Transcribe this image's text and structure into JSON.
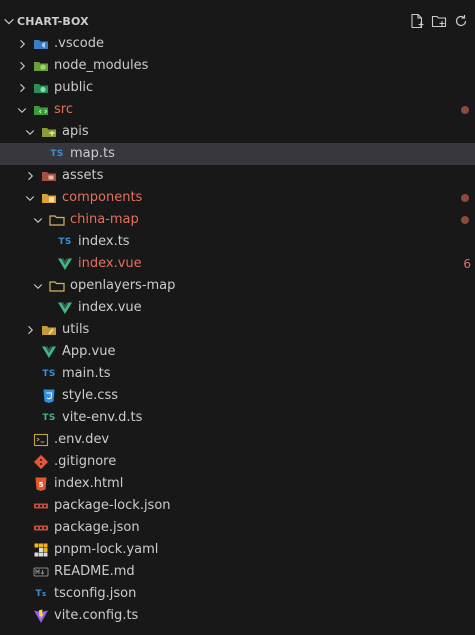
{
  "explorer": {
    "title": "CHART-BOX",
    "actions": [
      "new-file-icon",
      "new-folder-icon",
      "refresh-icon"
    ]
  },
  "tree": [
    {
      "label": ".vscode",
      "kind": "folder",
      "icon": "vscode-folder-icon",
      "depth": 0,
      "expanded": false
    },
    {
      "label": "node_modules",
      "kind": "folder",
      "icon": "node-folder-icon",
      "depth": 0,
      "expanded": false
    },
    {
      "label": "public",
      "kind": "folder",
      "icon": "public-folder-icon",
      "depth": 0,
      "expanded": false
    },
    {
      "label": "src",
      "kind": "folder",
      "icon": "src-folder-icon",
      "depth": 0,
      "expanded": true,
      "modified": true,
      "dot": true
    },
    {
      "label": "apis",
      "kind": "folder",
      "icon": "api-folder-icon",
      "depth": 1,
      "expanded": true
    },
    {
      "label": "map.ts",
      "kind": "file",
      "icon": "typescript-icon",
      "depth": 2,
      "selected": true
    },
    {
      "label": "assets",
      "kind": "folder",
      "icon": "assets-folder-icon",
      "depth": 1,
      "expanded": false
    },
    {
      "label": "components",
      "kind": "folder",
      "icon": "components-folder-icon",
      "depth": 1,
      "expanded": true,
      "modified": true,
      "dot": true
    },
    {
      "label": "china-map",
      "kind": "folder",
      "icon": "folder-icon",
      "depth": 2,
      "expanded": true,
      "modified": true,
      "dot": true
    },
    {
      "label": "index.ts",
      "kind": "file",
      "icon": "typescript-icon",
      "depth": 3
    },
    {
      "label": "index.vue",
      "kind": "file",
      "icon": "vue-icon",
      "depth": 3,
      "modified": true,
      "count": "6"
    },
    {
      "label": "openlayers-map",
      "kind": "folder",
      "icon": "folder-icon",
      "depth": 2,
      "expanded": true
    },
    {
      "label": "index.vue",
      "kind": "file",
      "icon": "vue-icon",
      "depth": 3
    },
    {
      "label": "utils",
      "kind": "folder",
      "icon": "utils-folder-icon",
      "depth": 1,
      "expanded": false
    },
    {
      "label": "App.vue",
      "kind": "file",
      "icon": "vue-icon",
      "depth": 1
    },
    {
      "label": "main.ts",
      "kind": "file",
      "icon": "typescript-icon",
      "depth": 1
    },
    {
      "label": "style.css",
      "kind": "file",
      "icon": "css-icon",
      "depth": 1
    },
    {
      "label": "vite-env.d.ts",
      "kind": "file",
      "icon": "typescript-def-icon",
      "depth": 1
    },
    {
      "label": ".env.dev",
      "kind": "file",
      "icon": "env-icon",
      "depth": 0
    },
    {
      "label": ".gitignore",
      "kind": "file",
      "icon": "git-icon",
      "depth": 0
    },
    {
      "label": "index.html",
      "kind": "file",
      "icon": "html-icon",
      "depth": 0
    },
    {
      "label": "package-lock.json",
      "kind": "file",
      "icon": "npm-icon",
      "depth": 0
    },
    {
      "label": "package.json",
      "kind": "file",
      "icon": "npm-icon",
      "depth": 0
    },
    {
      "label": "pnpm-lock.yaml",
      "kind": "file",
      "icon": "pnpm-icon",
      "depth": 0
    },
    {
      "label": "README.md",
      "kind": "file",
      "icon": "markdown-icon",
      "depth": 0
    },
    {
      "label": "tsconfig.json",
      "kind": "file",
      "icon": "tsconfig-icon",
      "depth": 0
    },
    {
      "label": "vite.config.ts",
      "kind": "file",
      "icon": "vite-icon",
      "depth": 0
    }
  ],
  "colors": {
    "background": "#181818",
    "selected_row": "#37373d",
    "modified_text": "#e2705f",
    "text": "#cccccc"
  }
}
